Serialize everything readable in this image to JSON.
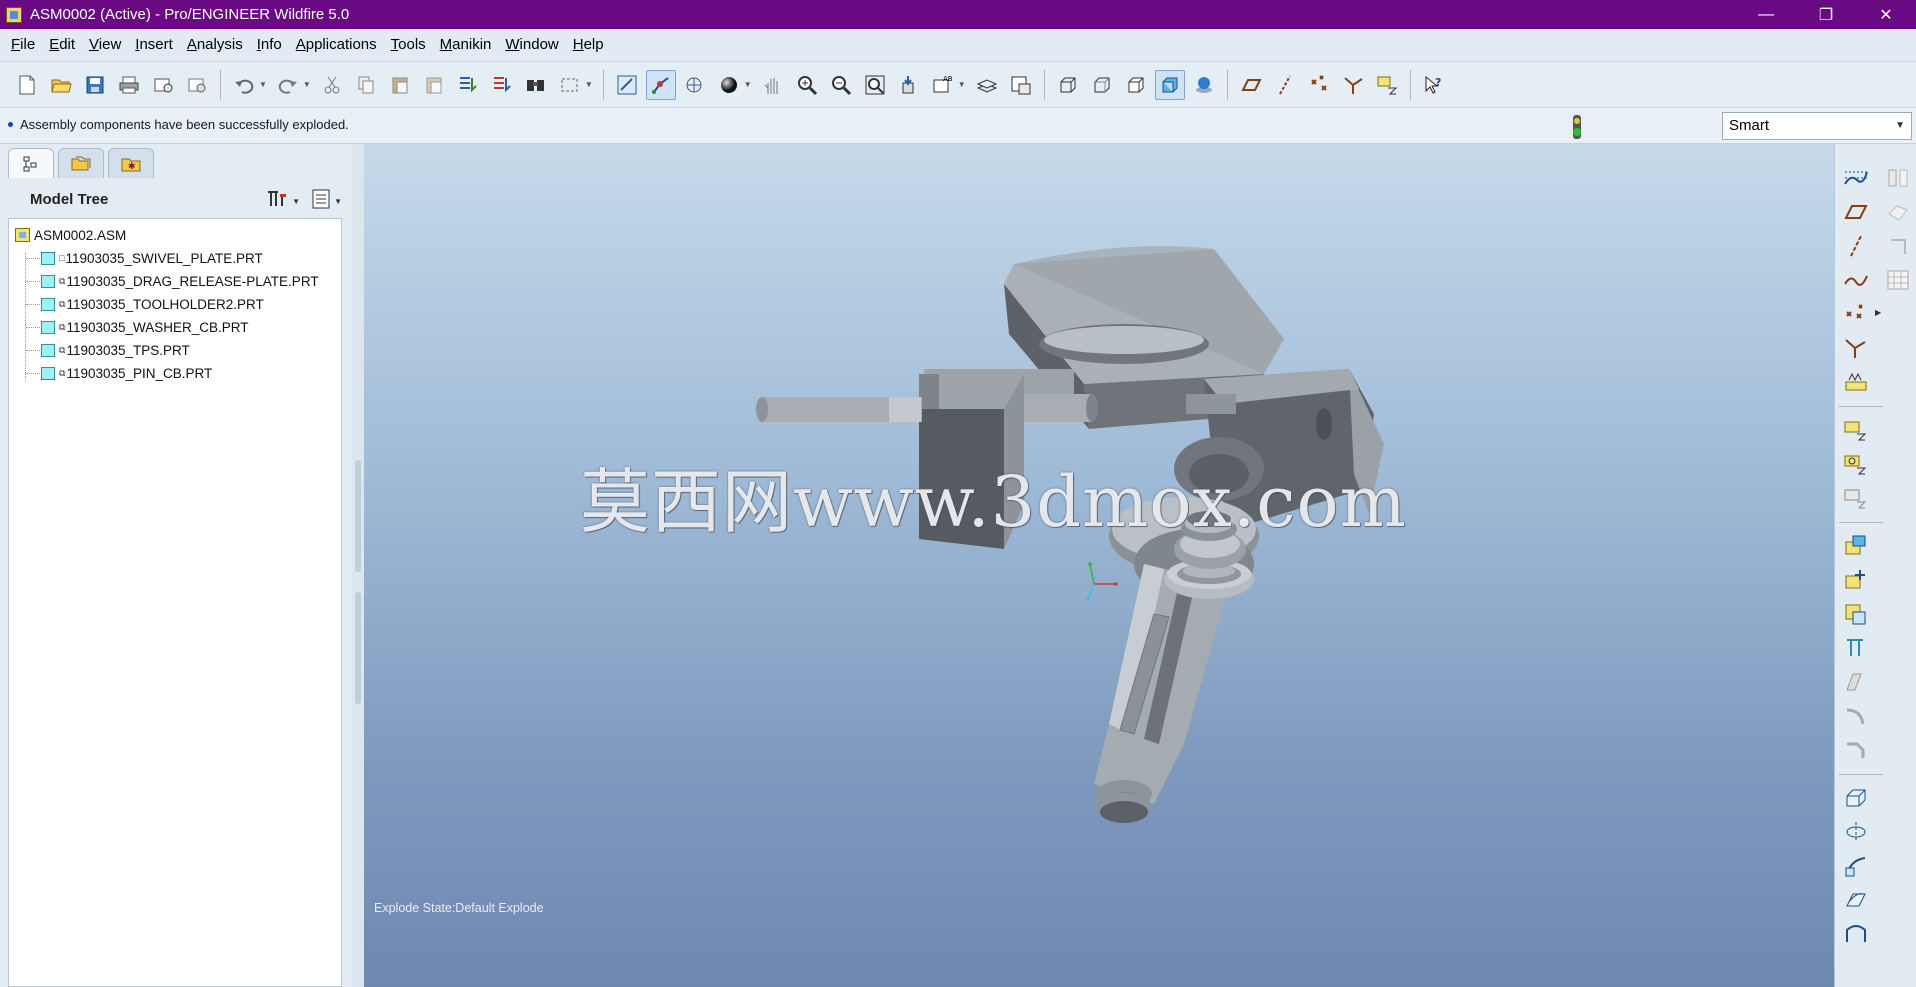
{
  "window": {
    "title": "ASM0002 (Active) - Pro/ENGINEER Wildfire 5.0",
    "controls": [
      "minimize",
      "restore",
      "close"
    ]
  },
  "menu": [
    {
      "label": "File",
      "u": "F",
      "rest": "ile"
    },
    {
      "label": "Edit",
      "u": "E",
      "rest": "dit"
    },
    {
      "label": "View",
      "u": "V",
      "rest": "iew"
    },
    {
      "label": "Insert",
      "u": "I",
      "rest": "nsert"
    },
    {
      "label": "Analysis",
      "u": "A",
      "rest": "nalysis"
    },
    {
      "label": "Info",
      "u": "I",
      "rest": "nfo"
    },
    {
      "label": "Applications",
      "u": "A",
      "rest": "pplications"
    },
    {
      "label": "Tools",
      "u": "T",
      "rest": "ools"
    },
    {
      "label": "Manikin",
      "u": "M",
      "rest": "anikin"
    },
    {
      "label": "Window",
      "u": "W",
      "rest": "indow"
    },
    {
      "label": "Help",
      "u": "H",
      "rest": "elp"
    }
  ],
  "status": {
    "message": "Assembly components have been successfully exploded.",
    "selection_filter": "Smart"
  },
  "model_tree": {
    "title": "Model Tree",
    "root": "ASM0002.ASM",
    "items": [
      "11903035_SWIVEL_PLATE.PRT",
      "11903035_DRAG_RELEASE-PLATE.PRT",
      "11903035_TOOLHOLDER2.PRT",
      "11903035_WASHER_CB.PRT",
      "11903035_TPS.PRT",
      "11903035_PIN_CB.PRT"
    ]
  },
  "viewport": {
    "explode_state": "Explode State:Default Explode",
    "watermark": "莫西网www.3dmox.com"
  },
  "colors": {
    "titlebar": "#6a0a82",
    "model_gray": "#8e959c",
    "accent": "#7ea7cf"
  }
}
